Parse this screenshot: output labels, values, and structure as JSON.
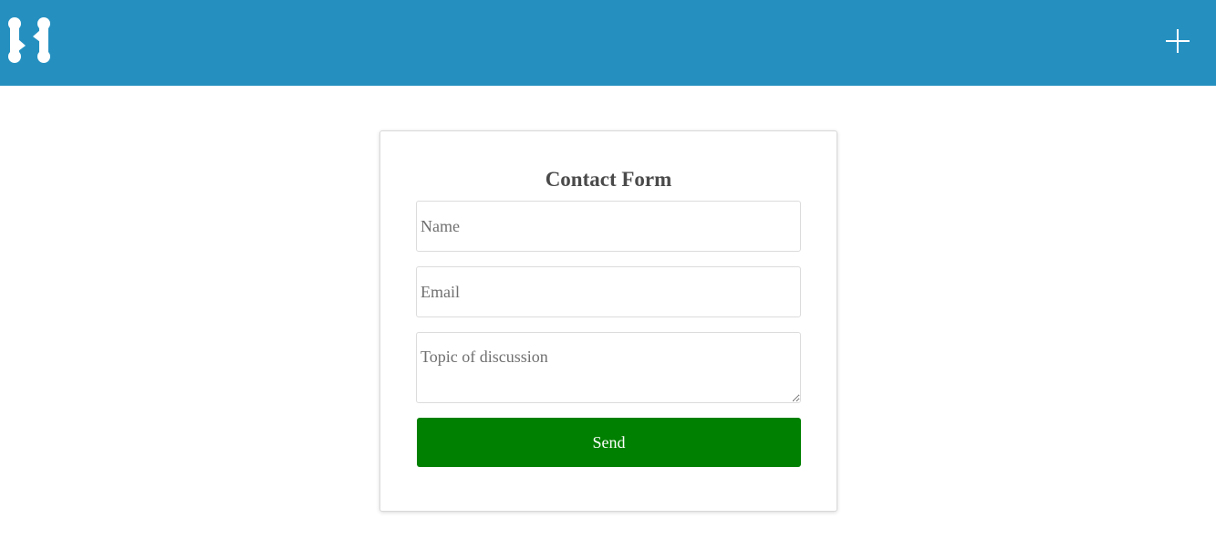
{
  "colors": {
    "header_background": "#2590c0",
    "header_icon": "#ffffff",
    "send_button": "#008000",
    "title_text": "#4a4a4a"
  },
  "header": {
    "logo_icon": "logo-icon",
    "add_icon": "plus-icon"
  },
  "contact_form": {
    "title": "Contact Form",
    "name": {
      "value": "",
      "placeholder": "Name"
    },
    "email": {
      "value": "",
      "placeholder": "Email"
    },
    "topic": {
      "value": "",
      "placeholder": "Topic of discussion"
    },
    "send_label": "Send"
  }
}
